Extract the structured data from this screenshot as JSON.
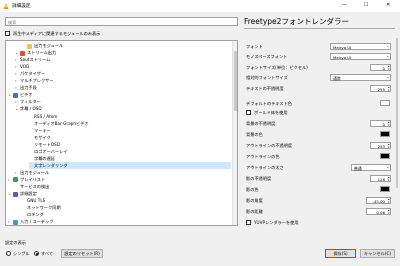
{
  "window": {
    "title": "詳細設定",
    "min_label": "—",
    "max_label": "☐",
    "close_label": "✕"
  },
  "search": {
    "placeholder": "検索"
  },
  "filter": {
    "label": "再生中メディアに関連するモジュールのみ表示",
    "checked": false
  },
  "tree": [
    {
      "label": "出力モジュール",
      "indent": 2,
      "icon": "folder-icon",
      "expand": false
    },
    {
      "label": "ストリーム出力",
      "indent": 1,
      "icon": "stream-output-icon",
      "expand": true
    },
    {
      "label": "Soutストリーム",
      "indent": 1,
      "icon": "",
      "expand": false,
      "arrow": "›"
    },
    {
      "label": "VOD",
      "indent": 1,
      "icon": "",
      "expand": false,
      "arrow": "›"
    },
    {
      "label": "パケタイザー",
      "indent": 1,
      "icon": "",
      "expand": false,
      "arrow": "›"
    },
    {
      "label": "マルチプレクサー",
      "indent": 1,
      "icon": "",
      "expand": false,
      "arrow": "›"
    },
    {
      "label": "出力手段",
      "indent": 1,
      "icon": "",
      "expand": false,
      "arrow": "›"
    },
    {
      "label": "ビデオ",
      "indent": 0,
      "icon": "video-icon",
      "expand": true
    },
    {
      "label": "フィルター",
      "indent": 1,
      "icon": "",
      "expand": false,
      "arrow": "›"
    },
    {
      "label": "字幕 / OSD",
      "indent": 1,
      "icon": "",
      "expand": true,
      "arrow": "⌄"
    },
    {
      "label": "RSS / Atom",
      "indent": 3,
      "icon": "",
      "expand": false
    },
    {
      "label": "オーディオBar Graphビデオ",
      "indent": 3,
      "icon": "",
      "expand": false
    },
    {
      "label": "マーキー",
      "indent": 3,
      "icon": "",
      "expand": false
    },
    {
      "label": "モザイク",
      "indent": 3,
      "icon": "",
      "expand": false
    },
    {
      "label": "リモートOSD",
      "indent": 3,
      "icon": "",
      "expand": false
    },
    {
      "label": "ロゴオーバーレイ",
      "indent": 3,
      "icon": "",
      "expand": false
    },
    {
      "label": "字幕の遅延",
      "indent": 3,
      "icon": "",
      "expand": false
    },
    {
      "label": "文字レンダリング",
      "indent": 3,
      "icon": "",
      "expand": false,
      "selected": true
    },
    {
      "label": "出力モジュール",
      "indent": 1,
      "icon": "",
      "expand": false,
      "arrow": "›"
    },
    {
      "label": "プレイリスト",
      "indent": 0,
      "icon": "playlist-icon",
      "expand": false,
      "arrow": "›"
    },
    {
      "label": "サービスの検出",
      "indent": 1,
      "icon": "",
      "expand": false
    },
    {
      "label": "詳細設定",
      "indent": 0,
      "icon": "advanced-icon",
      "expand": true,
      "arrow": "⌄"
    },
    {
      "label": "GNU TLS",
      "indent": 2,
      "icon": "",
      "expand": false
    },
    {
      "label": "ネットワーク同期",
      "indent": 2,
      "icon": "",
      "expand": false
    },
    {
      "label": "ロギング",
      "indent": 2,
      "icon": "",
      "expand": false
    },
    {
      "label": "入力 / コーデック",
      "indent": 0,
      "icon": "input-codec-icon",
      "expand": false,
      "arrow": "›"
    }
  ],
  "panel": {
    "title": "Freetype2フォントレンダラー",
    "font": {
      "label": "フォント",
      "value": "Meiryo UI"
    },
    "mono_font": {
      "label": "モノスペースフォント",
      "value": "Meiryo UI"
    },
    "font_size": {
      "label": "フォントサイズ(単位：ピクセル)",
      "value": "0"
    },
    "relative_size": {
      "label": "相対的フォントサイズ",
      "value": "通常"
    },
    "text_opacity": {
      "label": "テキストの不透明度",
      "value": "255"
    },
    "text_color": {
      "label": "デフォルトのテキスト色",
      "color": "#ffffff"
    },
    "bold": {
      "label": "ボールド体を使用",
      "checked": false
    },
    "bg_opacity": {
      "label": "背景の不透明度",
      "value": "0"
    },
    "bg_color": {
      "label": "背景の色",
      "color": "#000000"
    },
    "outline_opacity": {
      "label": "アウトラインの不透明度",
      "value": "255"
    },
    "outline_color": {
      "label": "アウトラインの色",
      "color": "#000000"
    },
    "outline_thickness": {
      "label": "アウトラインの太さ",
      "value": "普通"
    },
    "shadow_opacity": {
      "label": "影の不透明度",
      "value": "128"
    },
    "shadow_color": {
      "label": "影の色",
      "color": "#000000"
    },
    "shadow_angle": {
      "label": "影の角度",
      "value": "-45.00"
    },
    "shadow_distance": {
      "label": "影の距離",
      "value": "0.06"
    },
    "yuvp": {
      "label": "YUVPレンダラーを使用",
      "checked": false
    }
  },
  "footer": {
    "show_label": "設定の表示",
    "simple_label": "シンプル",
    "all_label": "すべて",
    "mode": "all",
    "reset_label": "設定のリセット(R)",
    "save_label": "保存(S)",
    "cancel_label": "キャンセル(C)"
  },
  "colors": {
    "accent": "#0078d7",
    "selection": "#cce8ff",
    "cone": "#f08c00"
  }
}
